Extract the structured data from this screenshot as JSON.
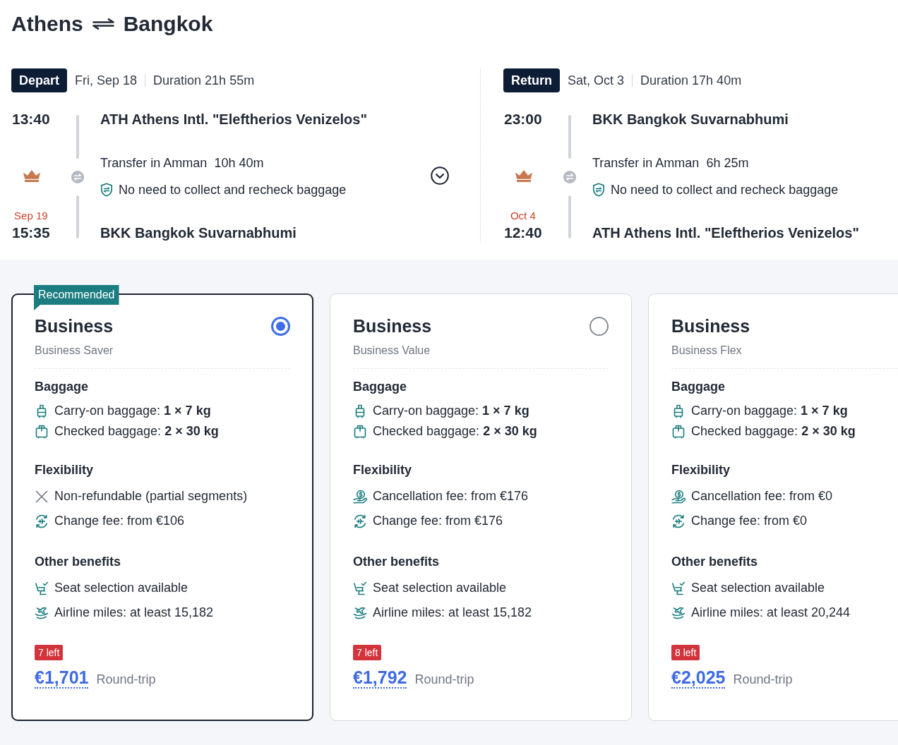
{
  "route": {
    "origin": "Athens",
    "destination": "Bangkok"
  },
  "legs": [
    {
      "label": "Depart",
      "date": "Fri, Sep 18",
      "duration": "Duration 21h 55m",
      "departure": {
        "time": "13:40",
        "airport": "ATH Athens Intl. \"Eleftherios Venizelos\""
      },
      "transfer": {
        "text": "Transfer in Amman",
        "duration": "10h 40m",
        "note": "No need to collect and recheck baggage"
      },
      "arrival": {
        "date": "Sep 19",
        "time": "15:35",
        "airport": "BKK Bangkok Suvarnabhumi"
      },
      "expandable": true
    },
    {
      "label": "Return",
      "date": "Sat, Oct 3",
      "duration": "Duration 17h 40m",
      "departure": {
        "time": "23:00",
        "airport": "BKK Bangkok Suvarnabhumi"
      },
      "transfer": {
        "text": "Transfer in Amman",
        "duration": "6h 25m",
        "note": "No need to collect and recheck baggage"
      },
      "arrival": {
        "date": "Oct 4",
        "time": "12:40",
        "airport": "ATH Athens Intl. \"Eleftherios Venizelos\""
      },
      "expandable": false
    }
  ],
  "fares": [
    {
      "tag": "Recommended",
      "selected": true,
      "cabin": "Business",
      "fare_name": "Business Saver",
      "sections": [
        {
          "heading": "Baggage",
          "items": [
            {
              "kind": "carry_on",
              "text": "Carry-on baggage: **1 × 7 kg**"
            },
            {
              "kind": "checked_bag",
              "text": "Checked baggage: **2 × 30 kg**"
            }
          ]
        },
        {
          "heading": "Flexibility",
          "items": [
            {
              "kind": "no_refund",
              "text": "Non-refundable (partial segments)"
            },
            {
              "kind": "change_fee",
              "text": "Change fee: from €106"
            }
          ]
        },
        {
          "heading": "Other benefits",
          "items": [
            {
              "kind": "seat",
              "text": "Seat selection available"
            },
            {
              "kind": "miles",
              "text": "Airline miles: at least 15,182"
            }
          ]
        }
      ],
      "seats_left": "7 left",
      "price": "€1,701",
      "price_note": "Round-trip"
    },
    {
      "selected": false,
      "cabin": "Business",
      "fare_name": "Business Value",
      "sections": [
        {
          "heading": "Baggage",
          "items": [
            {
              "kind": "carry_on",
              "text": "Carry-on baggage: **1 × 7 kg**"
            },
            {
              "kind": "checked_bag",
              "text": "Checked baggage: **2 × 30 kg**"
            }
          ]
        },
        {
          "heading": "Flexibility",
          "items": [
            {
              "kind": "cancellation_fee",
              "text": "Cancellation fee: from €176"
            },
            {
              "kind": "change_fee",
              "text": "Change fee: from €176"
            }
          ]
        },
        {
          "heading": "Other benefits",
          "items": [
            {
              "kind": "seat",
              "text": "Seat selection available"
            },
            {
              "kind": "miles",
              "text": "Airline miles: at least 15,182"
            }
          ]
        }
      ],
      "seats_left": "7 left",
      "price": "€1,792",
      "price_note": "Round-trip"
    },
    {
      "selected": false,
      "cabin": "Business",
      "fare_name": "Business Flex",
      "sections": [
        {
          "heading": "Baggage",
          "items": [
            {
              "kind": "carry_on",
              "text": "Carry-on baggage: **1 × 7 kg**"
            },
            {
              "kind": "checked_bag",
              "text": "Checked baggage: **2 × 30 kg**"
            }
          ]
        },
        {
          "heading": "Flexibility",
          "items": [
            {
              "kind": "cancellation_fee",
              "text": "Cancellation fee: from €0"
            },
            {
              "kind": "change_fee",
              "text": "Change fee: from €0"
            }
          ]
        },
        {
          "heading": "Other benefits",
          "items": [
            {
              "kind": "seat",
              "text": "Seat selection available"
            },
            {
              "kind": "miles",
              "text": "Airline miles: at least 20,244"
            }
          ]
        }
      ],
      "seats_left": "8 left",
      "price": "€2,025",
      "price_note": "Round-trip"
    }
  ]
}
